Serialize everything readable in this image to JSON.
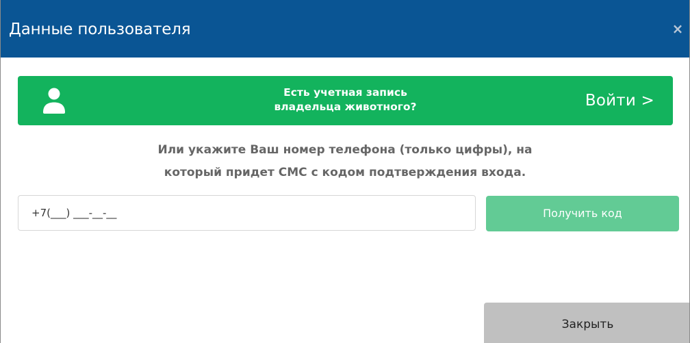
{
  "dialog": {
    "title": "Данные пользователя",
    "close_glyph": "×"
  },
  "login_banner": {
    "icon": "user-icon",
    "line1": "Есть учетная запись",
    "line2": "владельца животного?",
    "login_label": "Войти >",
    "color": "#13b35d"
  },
  "instruction": {
    "line1": "Или укажите Ваш номер телефона (только цифры), на",
    "line2": "который придет СМС с кодом подтверждения входа."
  },
  "phone": {
    "value": "",
    "placeholder": "+7(___) ___-__-__"
  },
  "get_code_button": {
    "label": "Получить код",
    "color": "#62cb95"
  },
  "footer": {
    "close_label": "Закрыть"
  },
  "colors": {
    "header": "#0a5594",
    "close_button": "#c0c0c0"
  }
}
